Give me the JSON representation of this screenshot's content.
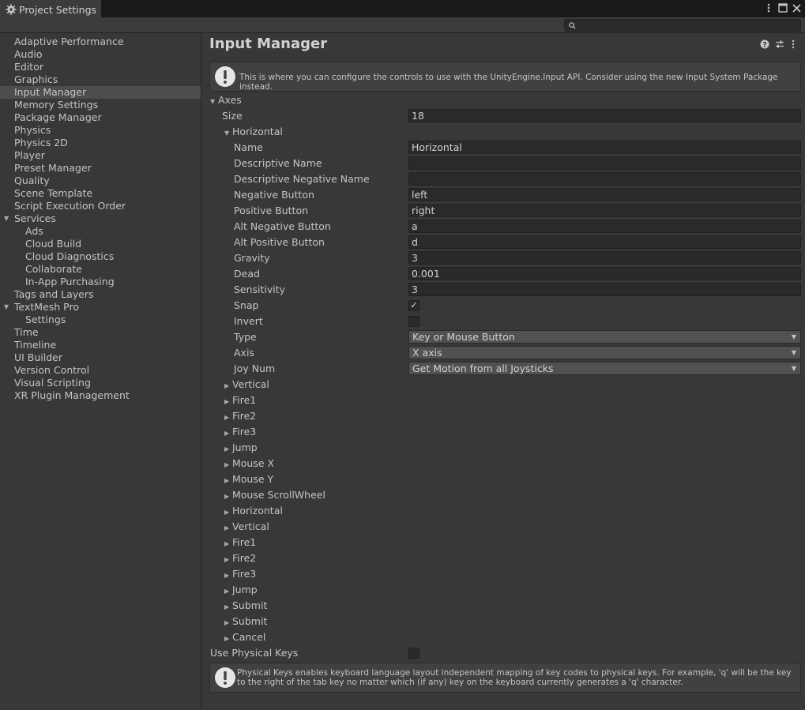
{
  "window": {
    "tab_title": "Project Settings",
    "menu_icon": "kebab-menu-icon",
    "maximize_icon": "maximize-icon",
    "close_icon": "close-icon"
  },
  "search": {
    "placeholder": "",
    "value": ""
  },
  "sidebar": {
    "items": [
      {
        "label": "Adaptive Performance",
        "level": 0
      },
      {
        "label": "Audio",
        "level": 0
      },
      {
        "label": "Editor",
        "level": 0
      },
      {
        "label": "Graphics",
        "level": 0
      },
      {
        "label": "Input Manager",
        "level": 0,
        "selected": true
      },
      {
        "label": "Memory Settings",
        "level": 0
      },
      {
        "label": "Package Manager",
        "level": 0
      },
      {
        "label": "Physics",
        "level": 0
      },
      {
        "label": "Physics 2D",
        "level": 0
      },
      {
        "label": "Player",
        "level": 0
      },
      {
        "label": "Preset Manager",
        "level": 0
      },
      {
        "label": "Quality",
        "level": 0
      },
      {
        "label": "Scene Template",
        "level": 0
      },
      {
        "label": "Script Execution Order",
        "level": 0
      },
      {
        "label": "Services",
        "level": 0,
        "expanded": true
      },
      {
        "label": "Ads",
        "level": 1
      },
      {
        "label": "Cloud Build",
        "level": 1
      },
      {
        "label": "Cloud Diagnostics",
        "level": 1
      },
      {
        "label": "Collaborate",
        "level": 1
      },
      {
        "label": "In-App Purchasing",
        "level": 1
      },
      {
        "label": "Tags and Layers",
        "level": 0
      },
      {
        "label": "TextMesh Pro",
        "level": 0,
        "expanded": true
      },
      {
        "label": "Settings",
        "level": 1
      },
      {
        "label": "Time",
        "level": 0
      },
      {
        "label": "Timeline",
        "level": 0
      },
      {
        "label": "UI Builder",
        "level": 0
      },
      {
        "label": "Version Control",
        "level": 0
      },
      {
        "label": "Visual Scripting",
        "level": 0
      },
      {
        "label": "XR Plugin Management",
        "level": 0
      }
    ]
  },
  "main": {
    "title": "Input Manager",
    "header_icons": [
      "help-icon",
      "preset-icon",
      "more-icon"
    ],
    "info_message": "This is where you can configure the controls to use with the UnityEngine.Input API. Consider using the new Input System Package instead.",
    "axes_label": "Axes",
    "size_label": "Size",
    "size_value": "18",
    "horizontal_label": "Horizontal",
    "fields": {
      "name": {
        "label": "Name",
        "value": "Horizontal"
      },
      "descriptive_name": {
        "label": "Descriptive Name",
        "value": ""
      },
      "descriptive_negative_name": {
        "label": "Descriptive Negative Name",
        "value": ""
      },
      "negative_button": {
        "label": "Negative Button",
        "value": "left"
      },
      "positive_button": {
        "label": "Positive Button",
        "value": "right"
      },
      "alt_negative_button": {
        "label": "Alt Negative Button",
        "value": "a"
      },
      "alt_positive_button": {
        "label": "Alt Positive Button",
        "value": "d"
      },
      "gravity": {
        "label": "Gravity",
        "value": "3"
      },
      "dead": {
        "label": "Dead",
        "value": "0.001"
      },
      "sensitivity": {
        "label": "Sensitivity",
        "value": "3"
      },
      "snap": {
        "label": "Snap",
        "checked": true,
        "mark": "✓"
      },
      "invert": {
        "label": "Invert",
        "checked": false
      },
      "type": {
        "label": "Type",
        "value": "Key or Mouse Button"
      },
      "axis": {
        "label": "Axis",
        "value": "X axis"
      },
      "joy_num": {
        "label": "Joy Num",
        "value": "Get Motion from all Joysticks"
      }
    },
    "collapsed_axes": [
      "Vertical",
      "Fire1",
      "Fire2",
      "Fire3",
      "Jump",
      "Mouse X",
      "Mouse Y",
      "Mouse ScrollWheel",
      "Horizontal",
      "Vertical",
      "Fire1",
      "Fire2",
      "Fire3",
      "Jump",
      "Submit",
      "Submit",
      "Cancel"
    ],
    "use_physical_keys": {
      "label": "Use Physical Keys",
      "checked": false
    },
    "physical_keys_message": "Physical Keys enables keyboard language layout independent mapping of key codes to physical keys. For example, 'q' will be the key to the right of the tab key no matter which (if any) key on the keyboard currently generates a 'q' character."
  }
}
